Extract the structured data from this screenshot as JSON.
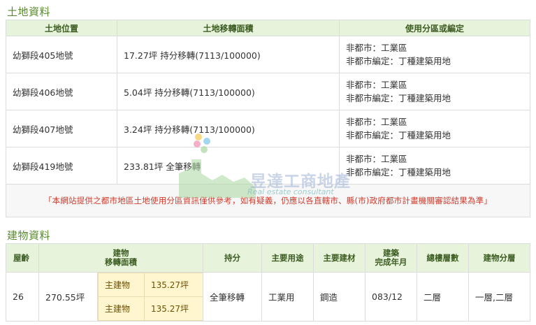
{
  "land_section": {
    "title": "土地資料",
    "headers": [
      "土地位置",
      "土地移轉面積",
      "使用分區或編定"
    ],
    "rows": [
      {
        "location": "幼獅段405地號",
        "area": "17.27坪 持分移轉(7113/100000)",
        "zone1": "非都市：工業區",
        "zone2": "非都市編定：丁種建築用地"
      },
      {
        "location": "幼獅段406地號",
        "area": "5.04坪 持分移轉(7113/100000)",
        "zone1": "非都市：工業區",
        "zone2": "非都市編定：丁種建築用地"
      },
      {
        "location": "幼獅段407地號",
        "area": "3.24坪 持分移轉(7113/100000)",
        "zone1": "非都市：工業區",
        "zone2": "非都市編定：丁種建築用地"
      },
      {
        "location": "幼獅段419地號",
        "area": "233.81坪 全筆移轉",
        "zone1": "非都市：工業區",
        "zone2": "非都市編定：丁種建築用地"
      }
    ],
    "notice": "「本網站提供之都市地區土地使用分區資訊僅供參考，如有疑義，仍應以各直轄市、縣(市)政府都市計畫機關審認結果為準」"
  },
  "building_section": {
    "title": "建物資料",
    "headers": {
      "age": "屋齡",
      "transfer_area_1": "建物",
      "transfer_area_2": "移轉面積",
      "share": "持分",
      "main_use": "主要用途",
      "main_material": "主要建材",
      "built_1": "建築",
      "built_2": "完成年月",
      "total_floors": "總樓層數",
      "floor": "建物分層"
    },
    "row": {
      "age": "26",
      "total_area": "270.55坪",
      "parts": [
        {
          "label": "主建物",
          "value": "135.27坪"
        },
        {
          "label": "主建物",
          "value": "135.27坪"
        }
      ],
      "share": "全筆移轉",
      "main_use": "工業用",
      "main_material": "鋼造",
      "built": "083/12",
      "total_floors": "二層",
      "floor": "一層,二層"
    }
  },
  "watermark": {
    "name": "昱達工商地產",
    "subtitle": "Real estate consultant"
  }
}
